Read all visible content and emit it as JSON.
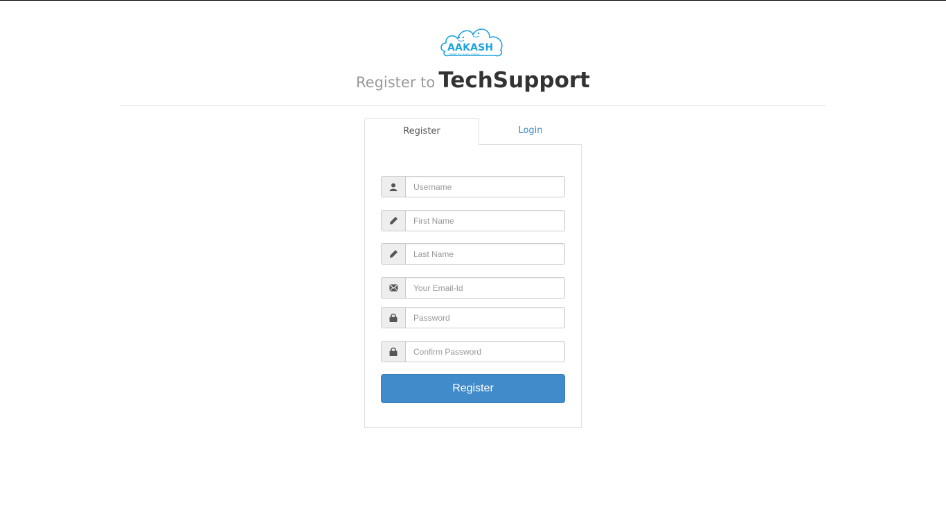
{
  "logo": {
    "wordmark": "AAKASH",
    "tagline": "tablet for every indian",
    "color": "#1ea3dd"
  },
  "heading": {
    "prefix": "Register to",
    "brand": "TechSupport"
  },
  "tabs": [
    {
      "label": "Register",
      "active": true
    },
    {
      "label": "Login",
      "active": false
    }
  ],
  "form": {
    "fields": [
      {
        "icon": "user-icon",
        "placeholder": "Username",
        "value": ""
      },
      {
        "icon": "pencil-icon",
        "placeholder": "First Name",
        "value": ""
      },
      {
        "icon": "pencil-icon",
        "placeholder": "Last Name",
        "value": ""
      },
      {
        "icon": "envelope-icon",
        "placeholder": "Your Email-Id",
        "value": ""
      },
      {
        "icon": "lock-icon",
        "placeholder": "Password",
        "value": ""
      },
      {
        "icon": "lock-icon",
        "placeholder": "Confirm Password",
        "value": ""
      }
    ],
    "submit_label": "Register"
  },
  "colors": {
    "primary": "#428bca",
    "link": "#428bca",
    "addon_bg": "#eeeeee"
  }
}
